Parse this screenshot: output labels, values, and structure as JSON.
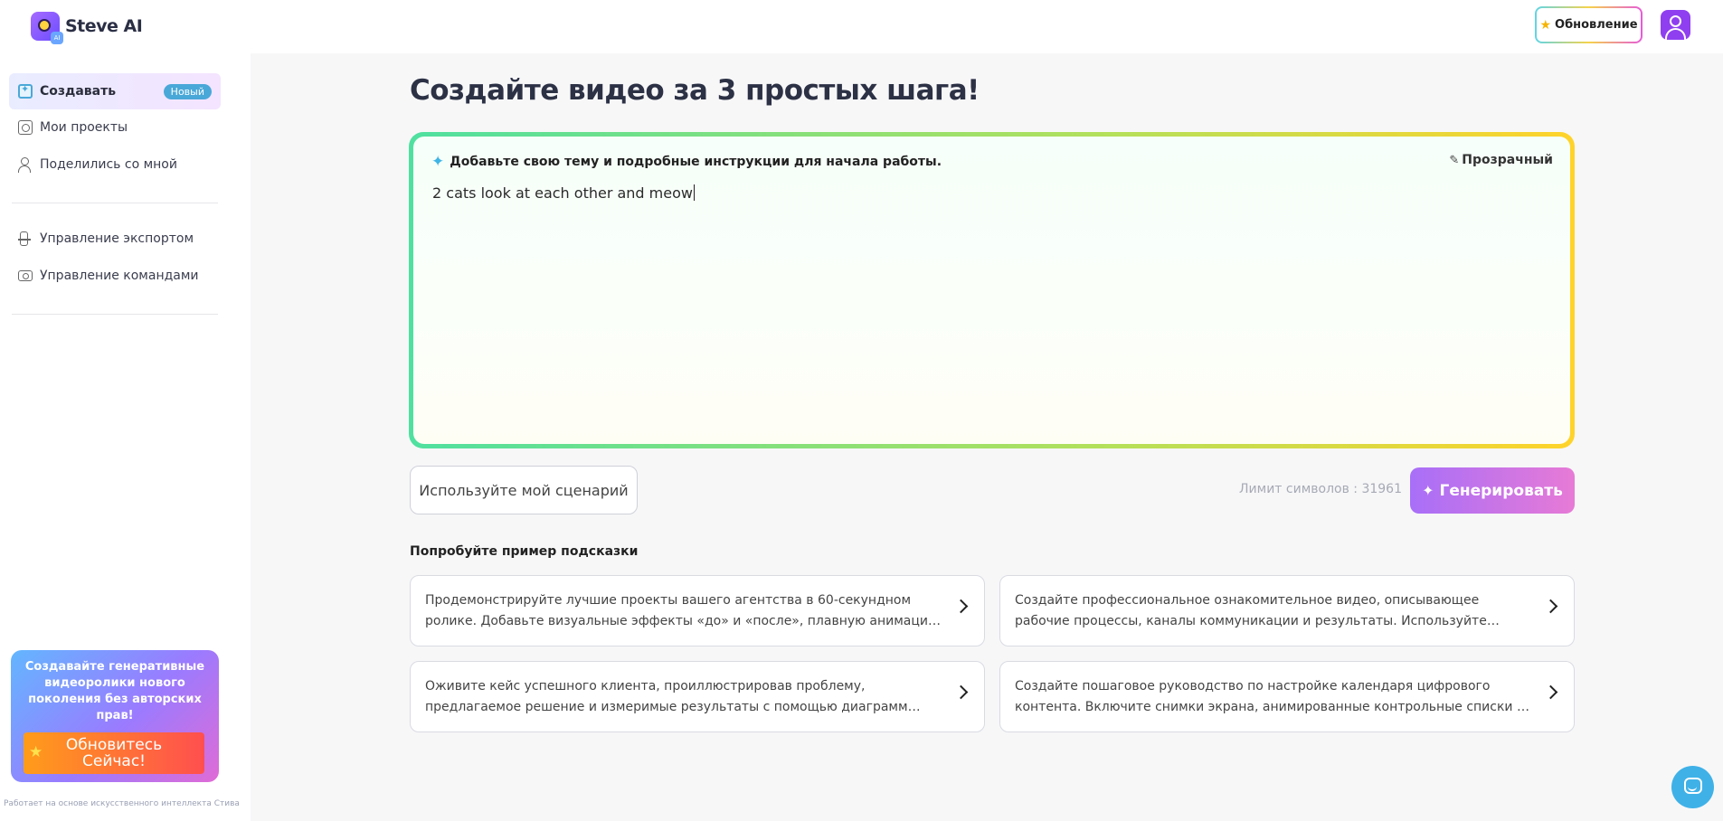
{
  "app": {
    "name": "Steve AI"
  },
  "header": {
    "upgrade_label": "Обновление"
  },
  "sidebar": {
    "items": [
      {
        "label": "Создавать",
        "badge": "Новый",
        "icon": "create-icon"
      },
      {
        "label": "Мои проекты",
        "icon": "projects-icon"
      },
      {
        "label": "Поделились со мной",
        "icon": "shared-user-icon"
      },
      {
        "label": "Управление экспортом",
        "icon": "export-icon"
      },
      {
        "label": "Управление командами",
        "icon": "team-icon"
      }
    ],
    "promo": {
      "text": "Создавайте генеративные видеоролики нового поколения без авторских прав!",
      "button": "Обновитесь Сейчас!"
    },
    "powered_by": "Работает на основе искусственного интеллекта Стива"
  },
  "main": {
    "title": "Создайте видео за 3 простых шага!",
    "prompt": {
      "heading": "Добавьте свою тему и подробные инструкции для начала работы.",
      "transparent_label": "Прозрачный",
      "value": "2 cats look at each other and meow"
    },
    "script_button": "Используйте мой сценарий",
    "char_limit": "Лимит символов : 31961",
    "generate_button": "Генерировать",
    "examples_title": "Попробуйте пример подсказки",
    "examples": [
      "Продемонстрируйте лучшие проекты вашего агентства в 60-секундном ролике. Добавьте визуальные эффекты «до» и «после», плавную анимацию и...",
      "Создайте профессиональное ознакомительное видео, описывающее рабочие процессы, каналы коммуникации и результаты. Используйте чёткую анимацию,...",
      "Оживите кейс успешного клиента, проиллюстрировав проблему, предлагаемое решение и измеримые результаты с помощью диаграмм данных, временных шк...",
      "Создайте пошаговое руководство по настройке календаря цифрового контента. Включите снимки экрана, анимированные контрольные списки и голосовые..."
    ]
  },
  "colors": {
    "accent_purple": "#a86ff8",
    "badge_blue": "#4aa8d8",
    "prompt_border_start": "#4fe0a0",
    "prompt_border_end": "#ffd32a"
  }
}
